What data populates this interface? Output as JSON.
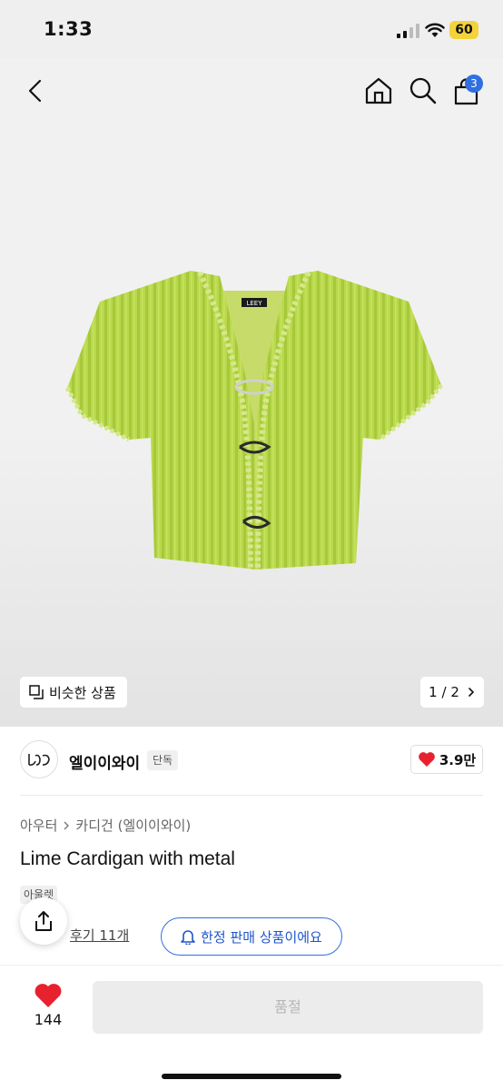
{
  "status_bar": {
    "time": "1:33",
    "battery": "60"
  },
  "nav": {
    "cart_count": "3"
  },
  "gallery": {
    "similar_label": "비슷한 상품",
    "current": "1",
    "separator": "/",
    "total": "2",
    "garment_label": "LEEY",
    "garment_color": "#b9d84c"
  },
  "brand": {
    "name": "엘이이와이",
    "exclusive": "단독",
    "likes": "3.9만"
  },
  "breadcrumb": {
    "category": "아우터",
    "subcategory": "카디건 (엘이이와이)"
  },
  "product": {
    "title": "Lime Cardigan with metal",
    "outlet_badge": "아울렛",
    "review_link": "후기 11개",
    "limited_label": "한정 판매 상품이에요"
  },
  "bottom": {
    "wish_count": "144",
    "soldout_label": "품절"
  },
  "colors": {
    "accent_blue": "#2f6fe0",
    "heart_red": "#e8212f",
    "badge_yellow": "#f3d33b"
  }
}
